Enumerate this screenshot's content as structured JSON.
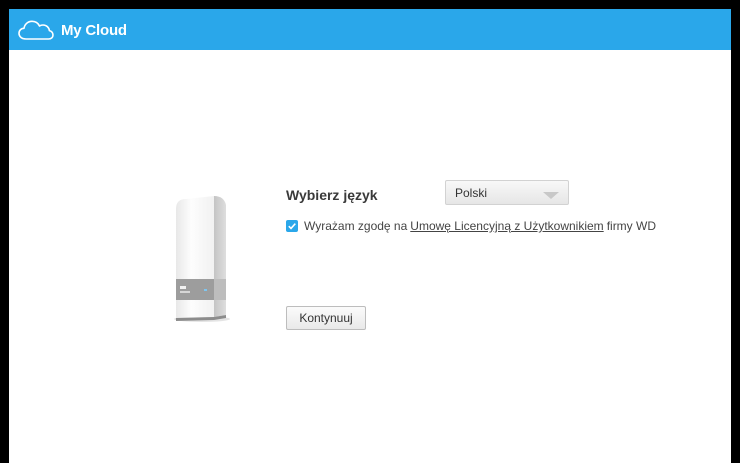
{
  "header": {
    "brand": "My Cloud"
  },
  "setup": {
    "language_label": "Wybierz język",
    "language_value": "Polski",
    "consent_checked": true,
    "consent_prefix": "Wyrażam zgodę na",
    "consent_link": "Umowę Licencyjną z Użytkownikiem",
    "consent_suffix": "firmy WD",
    "continue_label": "Kontynuuj"
  },
  "icons": {
    "logo": "cloud-icon",
    "device": "my-cloud-device-icon",
    "checkbox": "check-icon",
    "select": "chevron-down-icon"
  },
  "colors": {
    "accent": "#2aa7ea",
    "background": "#ffffff",
    "frame": "#000000"
  }
}
